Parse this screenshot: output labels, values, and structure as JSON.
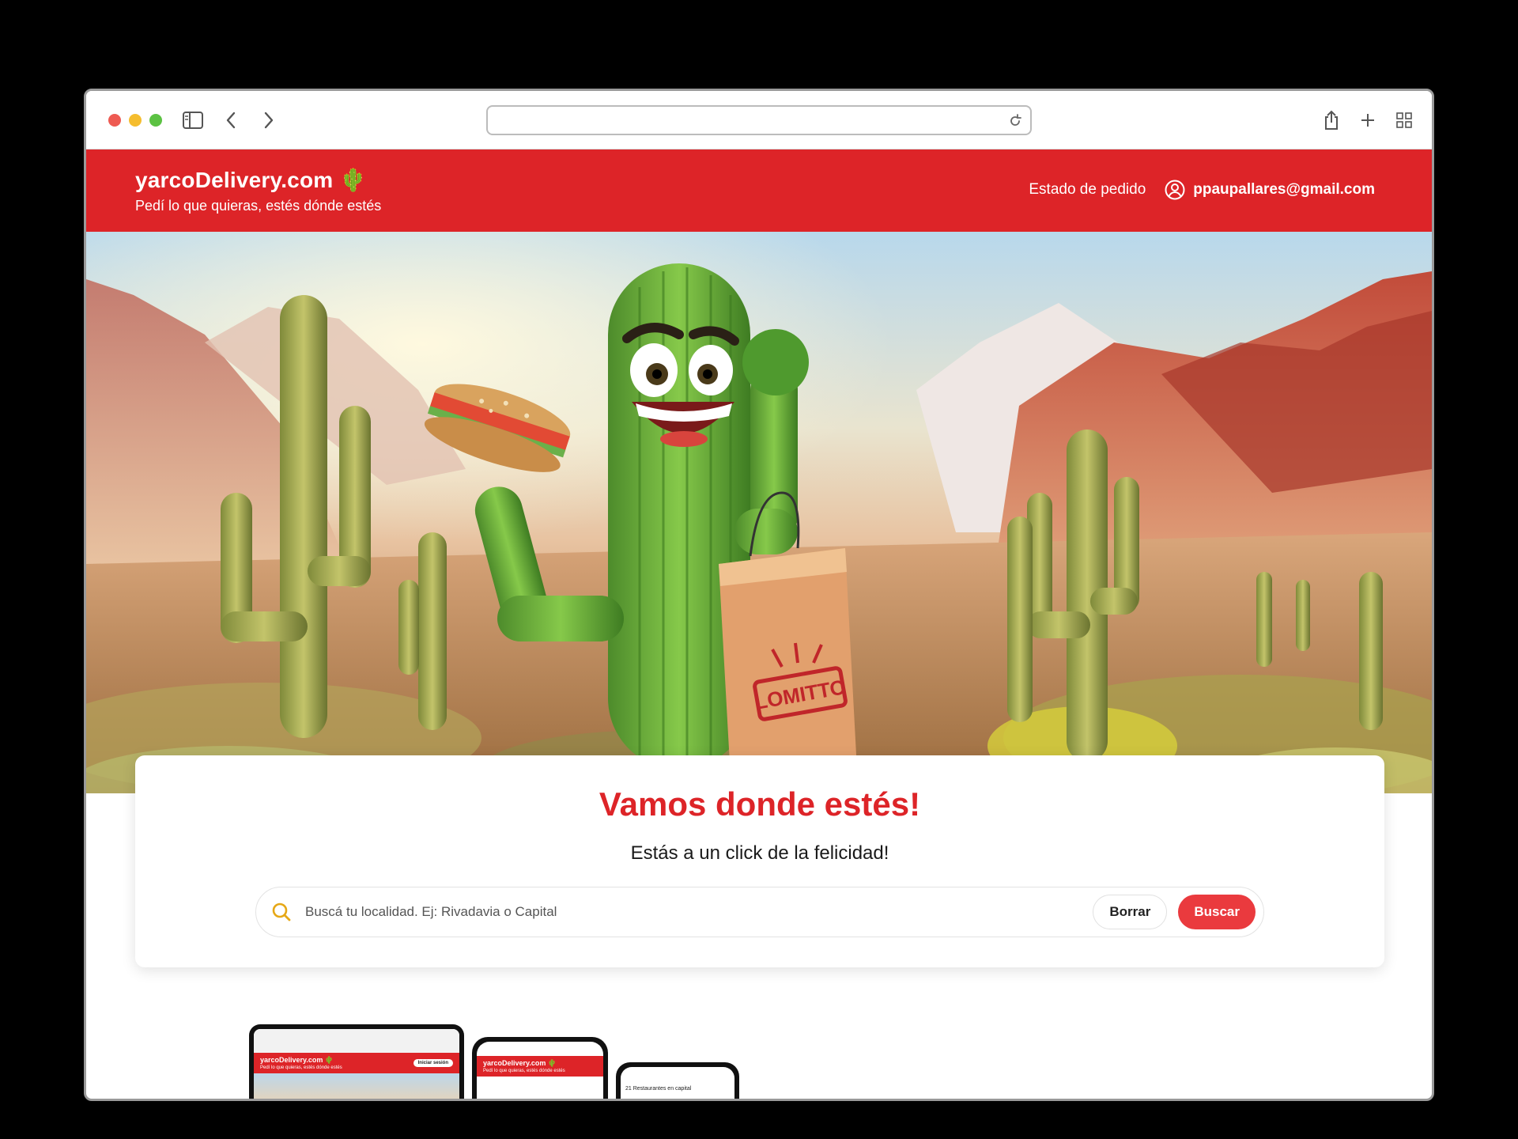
{
  "browser": {
    "url": ""
  },
  "header": {
    "brand": "yarcoDelivery.com 🌵",
    "tagline": "Pedí lo que quieras, estés dónde estés",
    "order_status": "Estado de pedido",
    "user_email": "ppaupallares@gmail.com"
  },
  "hero": {
    "bag_text": "LOMITTO"
  },
  "search_card": {
    "title": "Vamos donde estés!",
    "subtitle": "Estás a un click de la felicidad!",
    "placeholder": "Buscá tu localidad. Ej: Rivadavia o Capital",
    "clear_label": "Borrar",
    "search_label": "Buscar"
  },
  "devices": {
    "tablet_brand": "yarcoDelivery.com 🌵",
    "tablet_tagline": "Pedí lo que quieras, estés dónde estés",
    "tablet_button": "Iniciar sesión",
    "phone_brand": "yarcoDelivery.com 🌵",
    "phone_tagline": "Pedí lo que quieras, estés dónde estés",
    "phone2_text": "21 Restaurantes en capital"
  },
  "colors": {
    "brand_red": "#dd2428",
    "button_red": "#ea3a3e",
    "search_icon": "#e6a817"
  }
}
